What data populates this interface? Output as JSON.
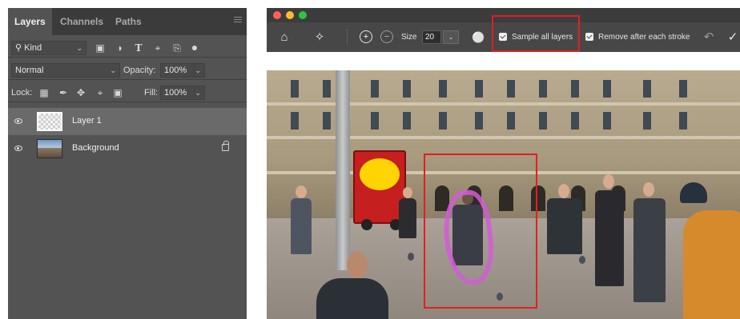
{
  "layers_panel": {
    "tabs": [
      "Layers",
      "Channels",
      "Paths"
    ],
    "filter_label": "Kind",
    "filter_icons": [
      "image-filter-icon",
      "adjustment-filter-icon",
      "type-filter-icon",
      "shape-filter-icon",
      "smart-object-filter-icon",
      "filter-toggle-icon"
    ],
    "blend_mode": "Normal",
    "opacity_label": "Opacity:",
    "opacity_value": "100%",
    "lock_label": "Lock:",
    "lock_icons": [
      "lock-transparent-icon",
      "lock-pixels-icon",
      "lock-position-icon",
      "lock-artboard-icon",
      "lock-all-icon"
    ],
    "fill_label": "Fill:",
    "fill_value": "100%",
    "layers": [
      {
        "name": "Layer 1",
        "selected": true,
        "thumbnail": "transparent"
      },
      {
        "name": "Background",
        "selected": false,
        "thumbnail": "photo",
        "locked": true
      }
    ]
  },
  "app_toolbar": {
    "icons": [
      "home-icon",
      "spot-healing-brush-icon",
      "add-stroke-icon",
      "subtract-stroke-icon",
      "pressure-icon",
      "undo-icon",
      "apply-icon"
    ],
    "size_label": "Size",
    "size_value": "20",
    "sample_all_layers_label": "Sample all layers",
    "sample_all_layers_checked": true,
    "remove_after_stroke_label": "Remove after each stroke",
    "remove_after_stroke_checked": true
  },
  "colors": {
    "highlight": "#e02020",
    "stroke": "#d35ad8",
    "panel_bg": "#535353",
    "toolbar_bg": "#474747"
  }
}
